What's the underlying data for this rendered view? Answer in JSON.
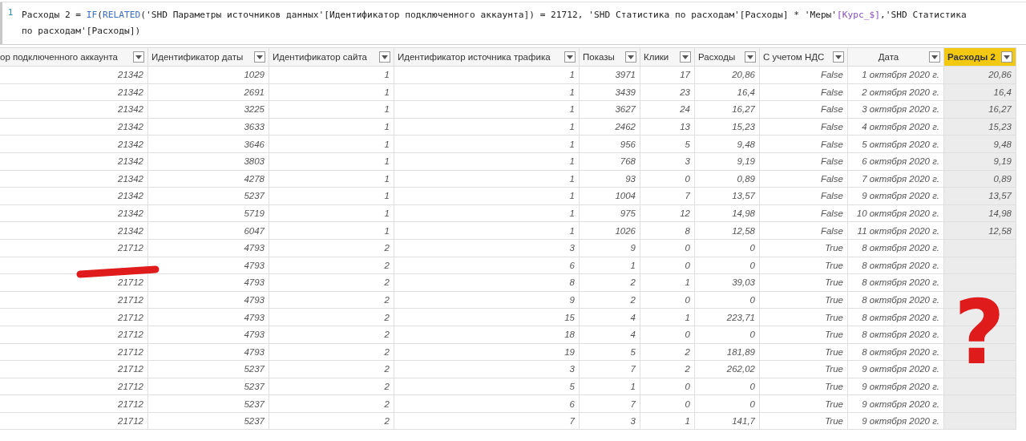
{
  "formula_bar": {
    "line_number": "1",
    "lines": [
      [
        {
          "kind": "text",
          "text": "Расходы 2 = "
        },
        {
          "kind": "function",
          "text": "IF"
        },
        {
          "kind": "text",
          "text": "("
        },
        {
          "kind": "function",
          "text": "RELATED"
        },
        {
          "kind": "text",
          "text": "('SHD Параметры источников данных'[Идентификатор подключенного аккаунта]) = 21712, 'SHD Статистика по расходам'[Расходы] * 'Меры'"
        },
        {
          "kind": "measure",
          "text": "[Курс_$]"
        },
        {
          "kind": "text",
          "text": ",'SHD Статистика"
        }
      ],
      [
        {
          "kind": "text",
          "text": "по расходам'[Расходы])"
        }
      ]
    ]
  },
  "table": {
    "columns": [
      {
        "label": "ор подключенного аккаунта",
        "selected": false,
        "kind": "number"
      },
      {
        "label": "Идентификатор даты",
        "selected": false,
        "kind": "number"
      },
      {
        "label": "Идентификатор сайта",
        "selected": false,
        "kind": "number"
      },
      {
        "label": "Идентификатор источника трафика",
        "selected": false,
        "kind": "number"
      },
      {
        "label": "Показы",
        "selected": false,
        "kind": "number"
      },
      {
        "label": "Клики",
        "selected": false,
        "kind": "number"
      },
      {
        "label": "Расходы",
        "selected": false,
        "kind": "number"
      },
      {
        "label": "С учетом НДС",
        "selected": false,
        "kind": "boolean"
      },
      {
        "label": "Дата",
        "selected": false,
        "kind": "date"
      },
      {
        "label": "Расходы 2",
        "selected": true,
        "kind": "number"
      }
    ],
    "rows": [
      [
        "21342",
        "1029",
        "1",
        "1",
        "3971",
        "17",
        "20,86",
        "False",
        "1 октября 2020 г.",
        "20,86"
      ],
      [
        "21342",
        "2691",
        "1",
        "1",
        "3439",
        "23",
        "16,4",
        "False",
        "2 октября 2020 г.",
        "16,4"
      ],
      [
        "21342",
        "3225",
        "1",
        "1",
        "3627",
        "24",
        "16,27",
        "False",
        "3 октября 2020 г.",
        "16,27"
      ],
      [
        "21342",
        "3633",
        "1",
        "1",
        "2462",
        "13",
        "15,23",
        "False",
        "4 октября 2020 г.",
        "15,23"
      ],
      [
        "21342",
        "3646",
        "1",
        "1",
        "956",
        "5",
        "9,48",
        "False",
        "5 октября 2020 г.",
        "9,48"
      ],
      [
        "21342",
        "3803",
        "1",
        "1",
        "768",
        "3",
        "9,19",
        "False",
        "6 октября 2020 г.",
        "9,19"
      ],
      [
        "21342",
        "4278",
        "1",
        "1",
        "93",
        "0",
        "0,89",
        "False",
        "7 октября 2020 г.",
        "0,89"
      ],
      [
        "21342",
        "5237",
        "1",
        "1",
        "1004",
        "7",
        "13,57",
        "False",
        "9 октября 2020 г.",
        "13,57"
      ],
      [
        "21342",
        "5719",
        "1",
        "1",
        "975",
        "12",
        "14,98",
        "False",
        "10 октября 2020 г.",
        "14,98"
      ],
      [
        "21342",
        "6047",
        "1",
        "1",
        "1026",
        "8",
        "12,58",
        "False",
        "11 октября 2020 г.",
        "12,58"
      ],
      [
        "21712",
        "4793",
        "2",
        "3",
        "9",
        "0",
        "0",
        "True",
        "8 октября 2020 г.",
        null
      ],
      [
        null,
        "4793",
        "2",
        "6",
        "1",
        "0",
        "0",
        "True",
        "8 октября 2020 г.",
        null
      ],
      [
        "21712",
        "4793",
        "2",
        "8",
        "2",
        "1",
        "39,03",
        "True",
        "8 октября 2020 г.",
        null
      ],
      [
        "21712",
        "4793",
        "2",
        "9",
        "2",
        "0",
        "0",
        "True",
        "8 октября 2020 г.",
        null
      ],
      [
        "21712",
        "4793",
        "2",
        "15",
        "4",
        "1",
        "223,71",
        "True",
        "8 октября 2020 г.",
        null
      ],
      [
        "21712",
        "4793",
        "2",
        "18",
        "4",
        "0",
        "0",
        "True",
        "8 октября 2020 г.",
        null
      ],
      [
        "21712",
        "4793",
        "2",
        "19",
        "5",
        "2",
        "181,89",
        "True",
        "8 октября 2020 г.",
        null
      ],
      [
        "21712",
        "5237",
        "2",
        "3",
        "7",
        "2",
        "262,02",
        "True",
        "9 октября 2020 г.",
        null
      ],
      [
        "21712",
        "5237",
        "2",
        "5",
        "1",
        "0",
        "0",
        "True",
        "9 октября 2020 г.",
        null
      ],
      [
        "21712",
        "5237",
        "2",
        "6",
        "7",
        "0",
        "0",
        "True",
        "9 октября 2020 г.",
        null
      ],
      [
        "21712",
        "5237",
        "2",
        "7",
        "3",
        "1",
        "141,7",
        "True",
        "9 октября 2020 г.",
        null
      ]
    ]
  },
  "annotation": {
    "mark": "?"
  }
}
